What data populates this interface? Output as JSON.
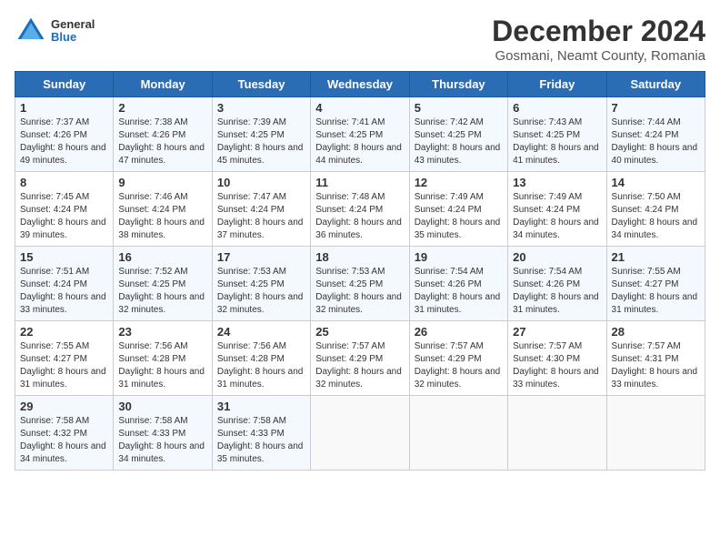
{
  "logo": {
    "general": "General",
    "blue": "Blue"
  },
  "title": "December 2024",
  "location": "Gosmani, Neamt County, Romania",
  "days_header": [
    "Sunday",
    "Monday",
    "Tuesday",
    "Wednesday",
    "Thursday",
    "Friday",
    "Saturday"
  ],
  "weeks": [
    [
      {
        "day": "1",
        "sunrise": "7:37 AM",
        "sunset": "4:26 PM",
        "daylight": "8 hours and 49 minutes."
      },
      {
        "day": "2",
        "sunrise": "7:38 AM",
        "sunset": "4:26 PM",
        "daylight": "8 hours and 47 minutes."
      },
      {
        "day": "3",
        "sunrise": "7:39 AM",
        "sunset": "4:25 PM",
        "daylight": "8 hours and 45 minutes."
      },
      {
        "day": "4",
        "sunrise": "7:41 AM",
        "sunset": "4:25 PM",
        "daylight": "8 hours and 44 minutes."
      },
      {
        "day": "5",
        "sunrise": "7:42 AM",
        "sunset": "4:25 PM",
        "daylight": "8 hours and 43 minutes."
      },
      {
        "day": "6",
        "sunrise": "7:43 AM",
        "sunset": "4:25 PM",
        "daylight": "8 hours and 41 minutes."
      },
      {
        "day": "7",
        "sunrise": "7:44 AM",
        "sunset": "4:24 PM",
        "daylight": "8 hours and 40 minutes."
      }
    ],
    [
      {
        "day": "8",
        "sunrise": "7:45 AM",
        "sunset": "4:24 PM",
        "daylight": "8 hours and 39 minutes."
      },
      {
        "day": "9",
        "sunrise": "7:46 AM",
        "sunset": "4:24 PM",
        "daylight": "8 hours and 38 minutes."
      },
      {
        "day": "10",
        "sunrise": "7:47 AM",
        "sunset": "4:24 PM",
        "daylight": "8 hours and 37 minutes."
      },
      {
        "day": "11",
        "sunrise": "7:48 AM",
        "sunset": "4:24 PM",
        "daylight": "8 hours and 36 minutes."
      },
      {
        "day": "12",
        "sunrise": "7:49 AM",
        "sunset": "4:24 PM",
        "daylight": "8 hours and 35 minutes."
      },
      {
        "day": "13",
        "sunrise": "7:49 AM",
        "sunset": "4:24 PM",
        "daylight": "8 hours and 34 minutes."
      },
      {
        "day": "14",
        "sunrise": "7:50 AM",
        "sunset": "4:24 PM",
        "daylight": "8 hours and 34 minutes."
      }
    ],
    [
      {
        "day": "15",
        "sunrise": "7:51 AM",
        "sunset": "4:24 PM",
        "daylight": "8 hours and 33 minutes."
      },
      {
        "day": "16",
        "sunrise": "7:52 AM",
        "sunset": "4:25 PM",
        "daylight": "8 hours and 32 minutes."
      },
      {
        "day": "17",
        "sunrise": "7:53 AM",
        "sunset": "4:25 PM",
        "daylight": "8 hours and 32 minutes."
      },
      {
        "day": "18",
        "sunrise": "7:53 AM",
        "sunset": "4:25 PM",
        "daylight": "8 hours and 32 minutes."
      },
      {
        "day": "19",
        "sunrise": "7:54 AM",
        "sunset": "4:26 PM",
        "daylight": "8 hours and 31 minutes."
      },
      {
        "day": "20",
        "sunrise": "7:54 AM",
        "sunset": "4:26 PM",
        "daylight": "8 hours and 31 minutes."
      },
      {
        "day": "21",
        "sunrise": "7:55 AM",
        "sunset": "4:27 PM",
        "daylight": "8 hours and 31 minutes."
      }
    ],
    [
      {
        "day": "22",
        "sunrise": "7:55 AM",
        "sunset": "4:27 PM",
        "daylight": "8 hours and 31 minutes."
      },
      {
        "day": "23",
        "sunrise": "7:56 AM",
        "sunset": "4:28 PM",
        "daylight": "8 hours and 31 minutes."
      },
      {
        "day": "24",
        "sunrise": "7:56 AM",
        "sunset": "4:28 PM",
        "daylight": "8 hours and 31 minutes."
      },
      {
        "day": "25",
        "sunrise": "7:57 AM",
        "sunset": "4:29 PM",
        "daylight": "8 hours and 32 minutes."
      },
      {
        "day": "26",
        "sunrise": "7:57 AM",
        "sunset": "4:29 PM",
        "daylight": "8 hours and 32 minutes."
      },
      {
        "day": "27",
        "sunrise": "7:57 AM",
        "sunset": "4:30 PM",
        "daylight": "8 hours and 33 minutes."
      },
      {
        "day": "28",
        "sunrise": "7:57 AM",
        "sunset": "4:31 PM",
        "daylight": "8 hours and 33 minutes."
      }
    ],
    [
      {
        "day": "29",
        "sunrise": "7:58 AM",
        "sunset": "4:32 PM",
        "daylight": "8 hours and 34 minutes."
      },
      {
        "day": "30",
        "sunrise": "7:58 AM",
        "sunset": "4:33 PM",
        "daylight": "8 hours and 34 minutes."
      },
      {
        "day": "31",
        "sunrise": "7:58 AM",
        "sunset": "4:33 PM",
        "daylight": "8 hours and 35 minutes."
      },
      null,
      null,
      null,
      null
    ]
  ]
}
